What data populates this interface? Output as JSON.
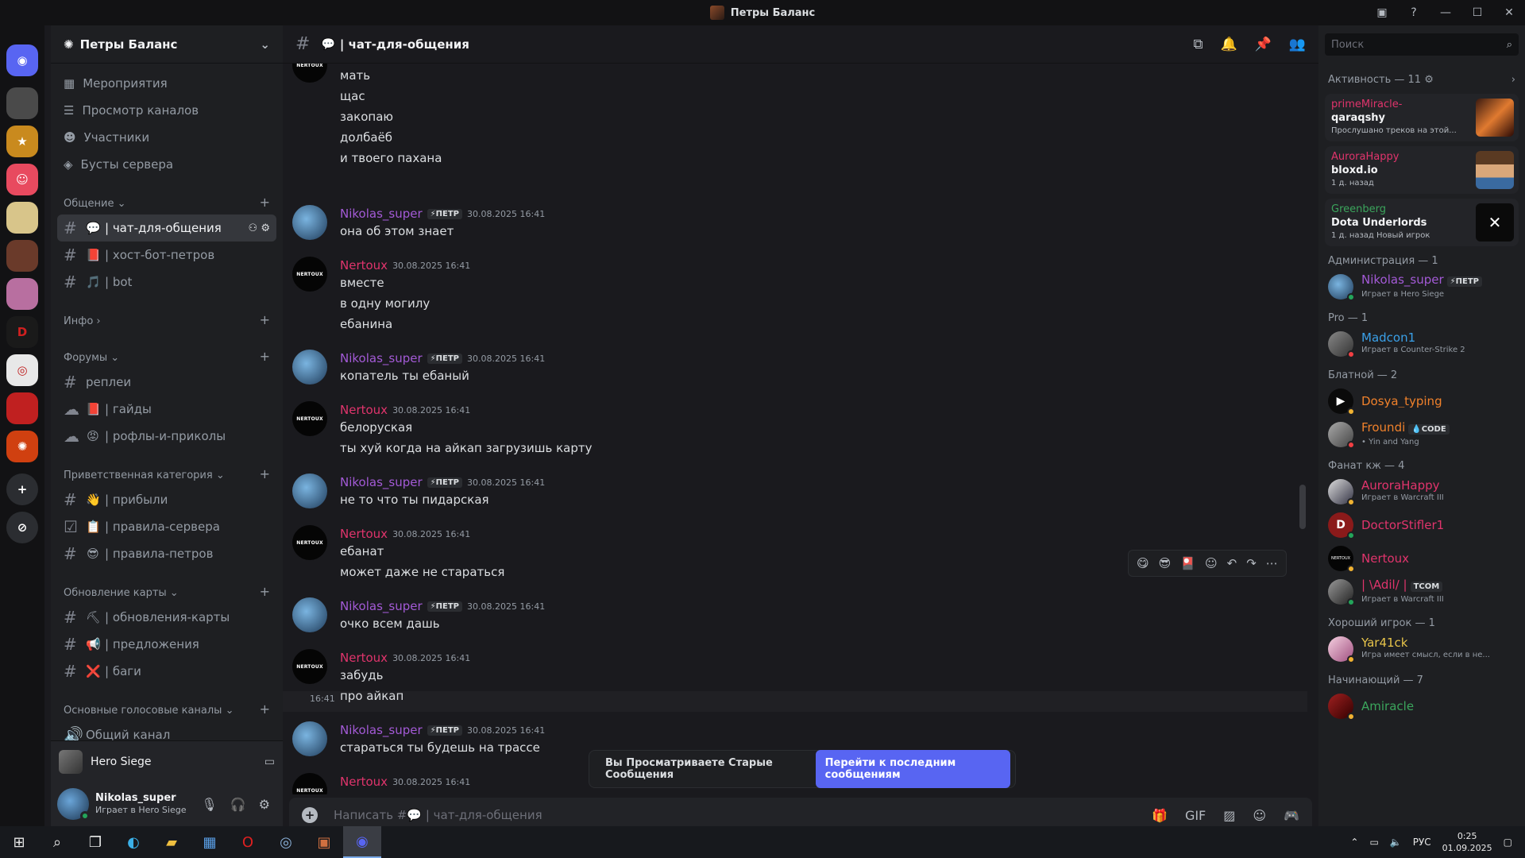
{
  "window": {
    "title": "Петры Баланс"
  },
  "server": {
    "name": "Петры Баланс",
    "nav": [
      {
        "icon": "calendar-icon",
        "label": "Мероприятия"
      },
      {
        "icon": "browse-channels-icon",
        "label": "Просмотр каналов"
      },
      {
        "icon": "members-icon",
        "label": "Участники"
      },
      {
        "icon": "boost-icon",
        "label": "Бусты сервера"
      }
    ],
    "categories": [
      {
        "name": "Общение",
        "channels": [
          {
            "emoji": "💬",
            "name": "| чат-для-общения",
            "active": true
          },
          {
            "emoji": "📕",
            "name": "| хост-бот-петров"
          },
          {
            "emoji": "🎵",
            "name": "| bot"
          }
        ]
      },
      {
        "name": "Инфо",
        "channels": []
      },
      {
        "name": "Форумы",
        "channels": [
          {
            "emoji": "",
            "name": "реплеи"
          },
          {
            "emoji": "📕",
            "name": "| гайды"
          },
          {
            "emoji": "😡",
            "name": "| рофлы-и-приколы"
          }
        ]
      },
      {
        "name": "Приветственная категория",
        "channels": [
          {
            "emoji": "👋",
            "name": "| прибыли"
          },
          {
            "emoji": "📋",
            "name": "| правила-сервера"
          },
          {
            "emoji": "😎",
            "name": "| правила-петров"
          }
        ]
      },
      {
        "name": "Обновление карты",
        "channels": [
          {
            "emoji": "⛏",
            "name": "| обновления-карты"
          },
          {
            "emoji": "📢",
            "name": "| предложения"
          },
          {
            "emoji": "❌",
            "name": "| баги"
          }
        ]
      },
      {
        "name": "Основные голосовые каналы",
        "channels": [
          {
            "emoji": "",
            "name": "Общий канал"
          }
        ]
      }
    ]
  },
  "voice_bar": {
    "title": "Hero Siege"
  },
  "user": {
    "name": "Nikolas_super",
    "status": "Играет в Hero Siege"
  },
  "chat": {
    "channel_name": "| чат-для-общения",
    "composer_placeholder": "Написать #💬 | чат-для-общения",
    "top_lines": [
      "мать",
      "щас",
      "закопаю",
      "долбаёб",
      "и твоего пахана"
    ],
    "messages": [
      {
        "author": "Nikolas_super",
        "tag": "⚡ПЕТР",
        "time": "30.08.2025 16:41",
        "lines": [
          "она об этом знает"
        ]
      },
      {
        "author": "Nertoux",
        "tag": "",
        "time": "30.08.2025 16:41",
        "lines": [
          "вместе",
          "в одну могилу",
          "ебанина"
        ]
      },
      {
        "author": "Nikolas_super",
        "tag": "⚡ПЕТР",
        "time": "30.08.2025 16:41",
        "lines": [
          "копатель ты ебаный"
        ]
      },
      {
        "author": "Nertoux",
        "tag": "",
        "time": "30.08.2025 16:41",
        "lines": [
          "белоруская",
          "ты хуй когда на айкап загрузишь карту"
        ]
      },
      {
        "author": "Nikolas_super",
        "tag": "⚡ПЕТР",
        "time": "30.08.2025 16:41",
        "lines": [
          "не то что ты пидарская"
        ]
      },
      {
        "author": "Nertoux",
        "tag": "",
        "time": "30.08.2025 16:41",
        "lines": [
          "ебанат",
          "может даже не стараться"
        ]
      },
      {
        "author": "Nikolas_super",
        "tag": "⚡ПЕТР",
        "time": "30.08.2025 16:41",
        "lines": [
          "очко всем дашь"
        ]
      },
      {
        "author": "Nertoux",
        "tag": "",
        "time": "30.08.2025 16:41",
        "lines": [
          "забудь",
          "про айкап"
        ]
      },
      {
        "author": "Nikolas_super",
        "tag": "⚡ПЕТР",
        "time": "30.08.2025 16:41",
        "lines": [
          "стараться ты будешь на трассе"
        ]
      },
      {
        "author": "Nertoux",
        "tag": "",
        "time": "30.08.2025 16:41",
        "lines": []
      }
    ],
    "hover_time": "16:41",
    "old_messages_notice": "Вы Просматриваете Старые Сообщения",
    "jump_button": "Перейти к последним сообщениям"
  },
  "members": {
    "search_placeholder": "Поиск",
    "activity_header": "Активность — 11",
    "activities": [
      {
        "user": "primeMiracle-",
        "user_color": "#e0346c",
        "game": "qaraqshy",
        "meta": "Прослушано треков на этой..."
      },
      {
        "user": "AuroraHappy",
        "user_color": "#e0346c",
        "game": "bloxd.io",
        "meta": "1 д. назад"
      },
      {
        "user": "Greenberg",
        "user_color": "#3ba55c",
        "game": "Dota Underlords",
        "meta": "1 д. назад  Новый игрок"
      }
    ],
    "groups": [
      {
        "title": "Администрация — 1",
        "members": [
          {
            "name": "Nikolas_super",
            "color": "#a35ad6",
            "badge": "⚡ПЕТР",
            "status": "Играет в Hero Siege"
          }
        ]
      },
      {
        "title": "Pro — 1",
        "members": [
          {
            "name": "Madcon1",
            "color": "#3aa0e8",
            "badge": "",
            "status": "Играет в Counter-Strike 2"
          }
        ]
      },
      {
        "title": "Блатной — 2",
        "members": [
          {
            "name": "Dosya_typing",
            "color": "#f0812b",
            "badge": "",
            "status": ""
          },
          {
            "name": "Froundi",
            "color": "#f0812b",
            "badge": "💧CODE",
            "status": "• Yin and Yang"
          }
        ]
      },
      {
        "title": "Фанат кж — 4",
        "members": [
          {
            "name": "AuroraHappy",
            "color": "#e0346c",
            "badge": "",
            "status": "Играет в Warcraft III"
          },
          {
            "name": "DoctorStifler1",
            "color": "#e0346c",
            "badge": "",
            "status": ""
          },
          {
            "name": "Nertoux",
            "color": "#e0346c",
            "badge": "",
            "status": ""
          },
          {
            "name": "| \\Adil/ |",
            "color": "#e0346c",
            "badge": "TCOM",
            "status": "Играет в Warcraft III"
          }
        ]
      },
      {
        "title": "Хороший игрок — 1",
        "members": [
          {
            "name": "Yar41ck",
            "color": "#e6c34a",
            "badge": "",
            "status": "Игра имеет смысл, если в не..."
          }
        ]
      },
      {
        "title": "Начинающий — 7",
        "members": [
          {
            "name": "Amiracle",
            "color": "#3ba55c",
            "badge": "",
            "status": ""
          }
        ]
      }
    ]
  },
  "taskbar": {
    "lang": "РУС",
    "time": "0:25",
    "date": "01.09.2025"
  }
}
